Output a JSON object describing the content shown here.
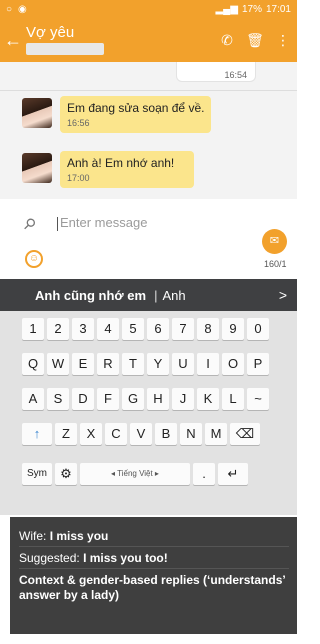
{
  "status": {
    "left_icons": [
      "circle-icon",
      "circle-dot-icon"
    ],
    "time": "17:01",
    "battery": "17%"
  },
  "appbar": {
    "back": "←",
    "title": "Vợ yêu",
    "call": "✆",
    "delete": "🗑",
    "more": "⋮"
  },
  "chat": {
    "prev_time": "16:54",
    "messages": [
      {
        "text": "Em đang sửa soạn để về.",
        "time": "16:56"
      },
      {
        "text": "Anh à! Em nhớ anh!",
        "time": "17:00"
      }
    ]
  },
  "composer": {
    "placeholder": "Enter message",
    "counter": "160/1"
  },
  "keyboard": {
    "suggestion_primary": "Anh cũng nhớ em",
    "suggestion_divider": "|",
    "suggestion_secondary": "Anh",
    "suggestion_arrow": ">",
    "row_numbers": [
      "1",
      "2",
      "3",
      "4",
      "5",
      "6",
      "7",
      "8",
      "9",
      "0"
    ],
    "row_q": [
      "Q",
      "W",
      "E",
      "R",
      "T",
      "Y",
      "U",
      "I",
      "O",
      "P"
    ],
    "row_a": [
      "A",
      "S",
      "D",
      "F",
      "G",
      "H",
      "J",
      "K",
      "L",
      "~"
    ],
    "row_z": [
      "Z",
      "X",
      "C",
      "V",
      "B",
      "N",
      "M"
    ],
    "shift": "↑",
    "backspace": "⌫",
    "sym": "Sym",
    "gear": "⚙",
    "lang": "◂ Tiếng Việt ▸",
    "dot": ".",
    "enter": "↵"
  },
  "caption": {
    "wife_label": "Wife:",
    "wife_text": "I miss you",
    "suggested_label": "Suggested:",
    "suggested_text": "I miss you too!",
    "note": "Context & gender-based replies (‘understands’ answer by a lady)"
  }
}
